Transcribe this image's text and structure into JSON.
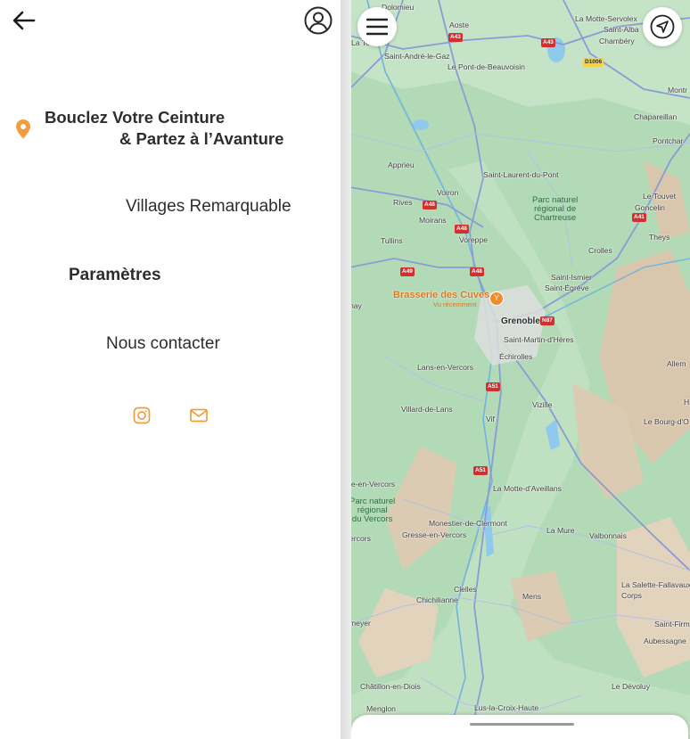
{
  "drawer": {
    "tagline_line1": "Bouclez Votre Ceinture",
    "tagline_line2": "& Partez à l’Avanture",
    "menu": [
      {
        "label": "Villages Remarquable"
      },
      {
        "label": "Paramètres"
      },
      {
        "label": "Nous contacter"
      }
    ],
    "icons": {
      "back": "arrow-left-icon",
      "account": "user-circle-icon",
      "location": "map-pin-icon",
      "instagram": "instagram-icon",
      "email": "mail-icon"
    },
    "accent_color": "#f39c3d"
  },
  "map": {
    "towns": {
      "dolomieu": "Dolomieu",
      "aoste": "Aoste",
      "la_motte_servolex": "La Motte-Servolex",
      "saint_alban": "Saint-Alba",
      "chambery": "Chambéry",
      "la_tour": "La Tou",
      "saint_andre_le_gaz": "Saint-André-le-Gaz",
      "le_pont_de_beauvoisin": "Le Pont-de-Beauvoisin",
      "montm": "Montr",
      "chapareillan": "Chapareillan",
      "pontcharra": "Pontchar",
      "apprieu": "Apprieu",
      "saint_laurent_du_pont": "Saint-Laurent-du-Pont",
      "voiron": "Voiron",
      "le_touvet": "Le Touvet",
      "goncelin": "Goncelin",
      "rives": "Rives",
      "moirans": "Moirans",
      "voreppe": "Voreppe",
      "theys": "Theys",
      "tullins": "Tullins",
      "crolles": "Crolles",
      "saint_ismier": "Saint-Ismier",
      "saint_egreve": "Saint-Égrève",
      "nay": "nay",
      "grenoble": "Grenoble",
      "saint_martin_d_heres": "Saint-Martin-d'Hères",
      "echirolles": "Échirolles",
      "allemont": "Allem",
      "lans_en_vercors": "Lans-en-Vercors",
      "villard_de_lans": "Villard-de-Lans",
      "vizille": "Vizille",
      "vif": "Vif",
      "le_bourg_d_oisans": "Le Bourg-d'O",
      "h": "H",
      "le_en_vercors": "le-en-Vercors",
      "la_motte_d_aveillans": "La Motte-d'Aveillans",
      "monestier_de_clermont": "Monestier-de-Clermont",
      "gresse_en_vercors": "Gresse-en-Vercors",
      "la_mure": "La Mure",
      "valbonnais": "Valbonnais",
      "ercors": "ercors",
      "clelles": "Clelles",
      "chichilianne": "Chichilianne",
      "mens": "Mens",
      "la_salette_fallavaux": "La Salette-Fallavaux",
      "corps": "Corps",
      "meyer": "meyer",
      "saint_firmin": "Saint-Firm",
      "aubessagne": "Aubessagne",
      "chatillon_en_diois": "Châtillon-en-Diois",
      "le_devoluy": "Le Dévoluy",
      "menglon": "Menglon",
      "lus_la_croix_haute": "Lus-la-Croix-Haute"
    },
    "parks": {
      "chartreuse": "Parc naturel\nrégional de\nChartreuse",
      "vercors": "Parc naturel\nrégional\ndu Vercors"
    },
    "roads": {
      "a43_1": "A43",
      "a43_2": "A43",
      "d1006": "D1006",
      "a48_1": "A48",
      "a48_2": "A48",
      "a48_3": "A48",
      "a49": "A49",
      "n87": "N87",
      "a41": "A41",
      "a51_1": "A51",
      "a51_2": "A51"
    },
    "poi": {
      "name": "Brasserie des Cuves",
      "subtitle": "Vu récemment",
      "icon": "cocktail-icon"
    },
    "buttons": {
      "menu": "hamburger-menu-icon",
      "locate": "navigation-arrow-icon"
    },
    "colors": {
      "land": "#b3dab6",
      "road": "#8b9bd6",
      "mountain": "#d9c7ad",
      "water": "#8fc9ec"
    }
  }
}
